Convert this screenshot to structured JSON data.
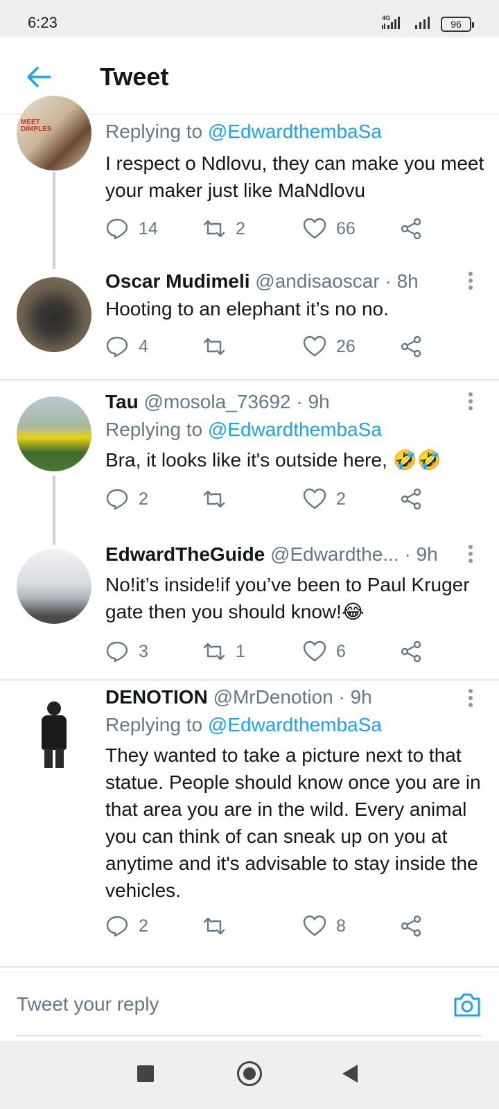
{
  "status_bar": {
    "time": "6:23",
    "network": "4G",
    "battery": "96"
  },
  "header": {
    "title": "Tweet",
    "back_icon": "arrow-left-icon"
  },
  "colors": {
    "accent": "#1da1f2",
    "secondary_text": "#657786",
    "thread_line": "#c8d0d8"
  },
  "tweets": [
    {
      "name": "",
      "handle": "",
      "time": "",
      "replying_prefix": "Replying to ",
      "replying_to": "@EdwardthembaSa",
      "text": "I respect o Ndlovu, they can make you meet your maker just like MaNdlovu",
      "replies": "14",
      "retweets": "2",
      "likes": "66"
    },
    {
      "name": "Oscar Mudimeli",
      "handle": "@andisaoscar",
      "time": "· 8h",
      "text": "Hooting to an elephant it’s no no.",
      "replies": "4",
      "retweets": "",
      "likes": "26"
    },
    {
      "name": "Tau",
      "handle": "@mosola_73692",
      "time": "· 9h",
      "replying_prefix": "Replying to ",
      "replying_to": "@EdwardthembaSa",
      "text": "Bra, it looks like it's outside here, 🤣🤣",
      "replies": "2",
      "retweets": "",
      "likes": "2"
    },
    {
      "name": "EdwardTheGuide",
      "handle": "@Edwardthe...",
      "time": "· 9h",
      "text": "No!it’s inside!if you’ve been to Paul Kruger gate then you should know!😂",
      "replies": "3",
      "retweets": "1",
      "likes": "6"
    },
    {
      "name": "DENOTION",
      "handle": "@MrDenotion",
      "time": "· 9h",
      "replying_prefix": "Replying to ",
      "replying_to": "@EdwardthembaSa",
      "text": "They wanted to take a picture next to that statue. People should know once you are in that area you are in the wild. Every animal you can think of can sneak up on you at anytime and it's advisable to stay inside the vehicles.",
      "replies": "2",
      "retweets": "",
      "likes": "8"
    }
  ],
  "reply_bar": {
    "placeholder": "Tweet your reply",
    "icon": "camera-icon"
  },
  "nav": {
    "recents_icon": "square-icon",
    "home_icon": "circle-icon",
    "back_icon": "triangle-back-icon"
  }
}
